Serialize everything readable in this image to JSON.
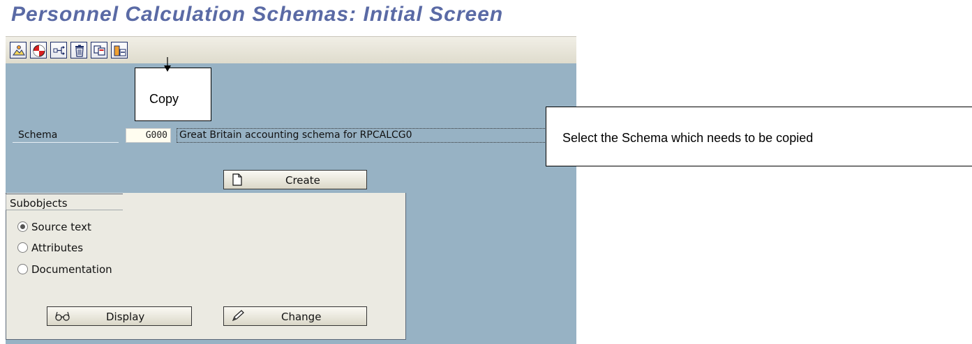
{
  "window": {
    "title": "Personnel Calculation Schemas: Initial Screen"
  },
  "toolbar": {
    "buttons": [
      {
        "icon": "other-object-icon"
      },
      {
        "icon": "check-icon"
      },
      {
        "icon": "where-used-icon"
      },
      {
        "icon": "delete-icon"
      },
      {
        "icon": "copy-icon"
      },
      {
        "icon": "rename-icon"
      }
    ]
  },
  "callouts": {
    "copy": "Copy",
    "select_schema": "Select the Schema which needs to be copied"
  },
  "schema": {
    "label": "Schema",
    "value": "G000",
    "description": "Great Britain accounting schema for RPCALCG0"
  },
  "buttons": {
    "create": "Create",
    "display": "Display",
    "change": "Change"
  },
  "subobjects": {
    "title": "Subobjects",
    "options": [
      {
        "label": "Source text",
        "selected": true
      },
      {
        "label": "Attributes",
        "selected": false
      },
      {
        "label": "Documentation",
        "selected": false
      }
    ]
  }
}
